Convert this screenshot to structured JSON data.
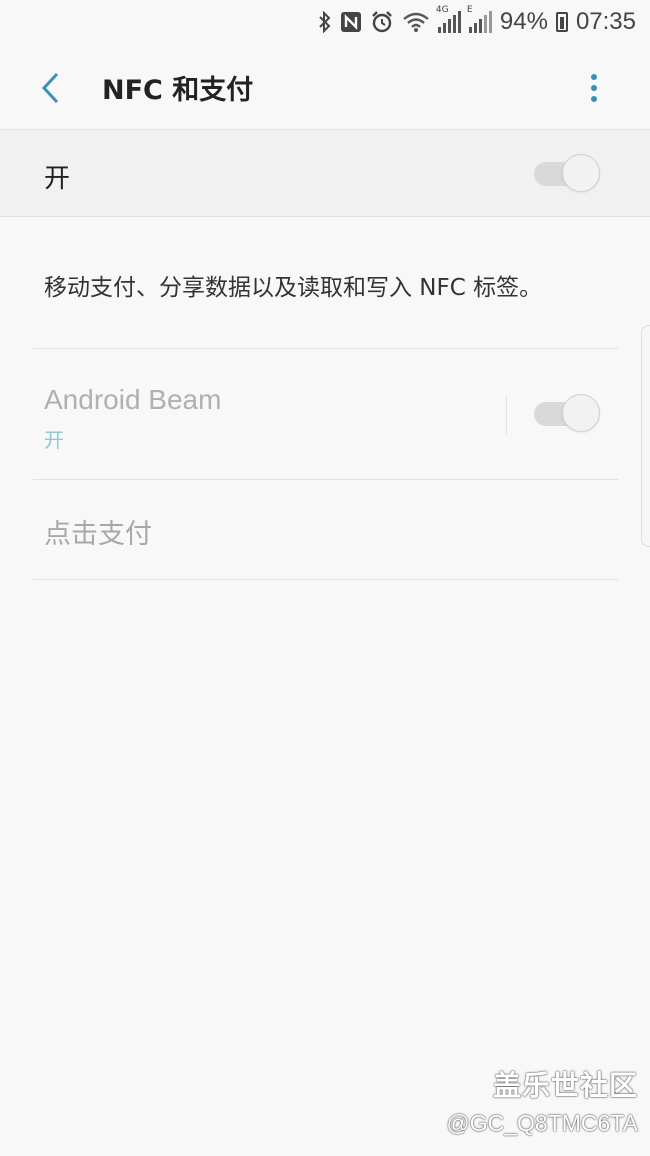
{
  "status_bar": {
    "icons": [
      "bluetooth-icon",
      "nfc-icon",
      "alarm-icon",
      "wifi-icon",
      "signal-4g-icon",
      "signal-e-icon"
    ],
    "network_4g": "4G",
    "network_e": "E",
    "battery_percent": "94%",
    "time": "07:35"
  },
  "app_bar": {
    "title": "NFC 和支付",
    "back_icon": "chevron-left-icon",
    "menu_icon": "more-vert-icon"
  },
  "master_switch": {
    "label": "开",
    "on": true
  },
  "description": "移动支付、分享数据以及读取和写入 NFC 标签。",
  "settings": [
    {
      "title": "Android Beam",
      "subtitle": "开",
      "toggle_on": true,
      "enabled": false
    },
    {
      "title": "点击支付",
      "enabled": false
    }
  ],
  "watermark": {
    "line1": "盖乐世社区",
    "line2": "@GC_Q8TMC6TA"
  },
  "colors": {
    "accent": "#3a8fb5",
    "subtitle": "#93c5d8",
    "background": "#f8f8f8"
  }
}
